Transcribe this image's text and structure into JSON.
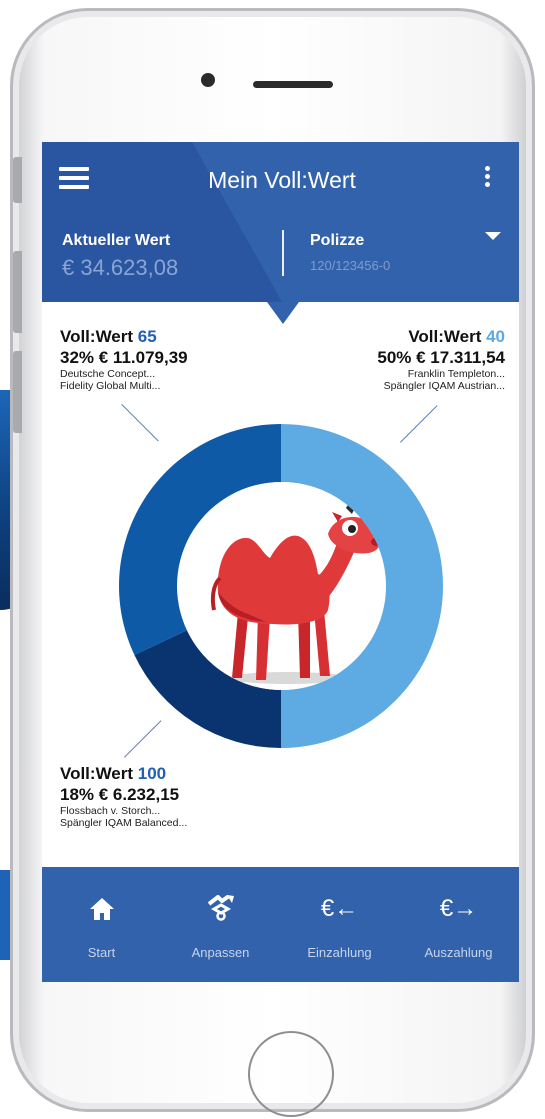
{
  "header": {
    "title": "Mein Voll:Wert",
    "current_value_label": "Aktueller Wert",
    "current_value": "€ 34.623,08",
    "policy_label": "Polizze",
    "policy_number": "120/123456-0"
  },
  "funds": [
    {
      "name_prefix": "Voll:Wert ",
      "name_number": "65",
      "share_amount": "32% € 11.079,39",
      "lines": [
        "Deutsche Concept...",
        "Fidelity Global Multi..."
      ],
      "color": "#0f5aa6"
    },
    {
      "name_prefix": "Voll:Wert ",
      "name_number": "40",
      "share_amount": "50% € 17.311,54",
      "lines": [
        "Franklin Templeton...",
        "Spängler IQAM Austrian..."
      ],
      "color": "#5eaae3"
    },
    {
      "name_prefix": "Voll:Wert ",
      "name_number": "100",
      "share_amount": "18% € 6.232,15",
      "lines": [
        "Flossbach v. Storch...",
        "Spängler IQAM Balanced..."
      ],
      "color": "#0a3470"
    }
  ],
  "allocation": {
    "type": "donut",
    "segments": [
      {
        "label": "Voll:Wert 40",
        "percent": 50,
        "color": "#5eaae3"
      },
      {
        "label": "Voll:Wert 100",
        "percent": 18,
        "color": "#0a3470"
      },
      {
        "label": "Voll:Wert 65",
        "percent": 32,
        "color": "#0f5aa6"
      }
    ]
  },
  "nav": [
    {
      "label": "Start",
      "icon": "home-icon"
    },
    {
      "label": "Anpassen",
      "icon": "adjust-icon"
    },
    {
      "label": "Einzahlung",
      "icon": "euro-in-icon"
    },
    {
      "label": "Auszahlung",
      "icon": "euro-out-icon"
    }
  ],
  "colors": {
    "primary": "#3262ac",
    "accent": "#1f5fb4",
    "light_accent": "#5eaae3"
  }
}
